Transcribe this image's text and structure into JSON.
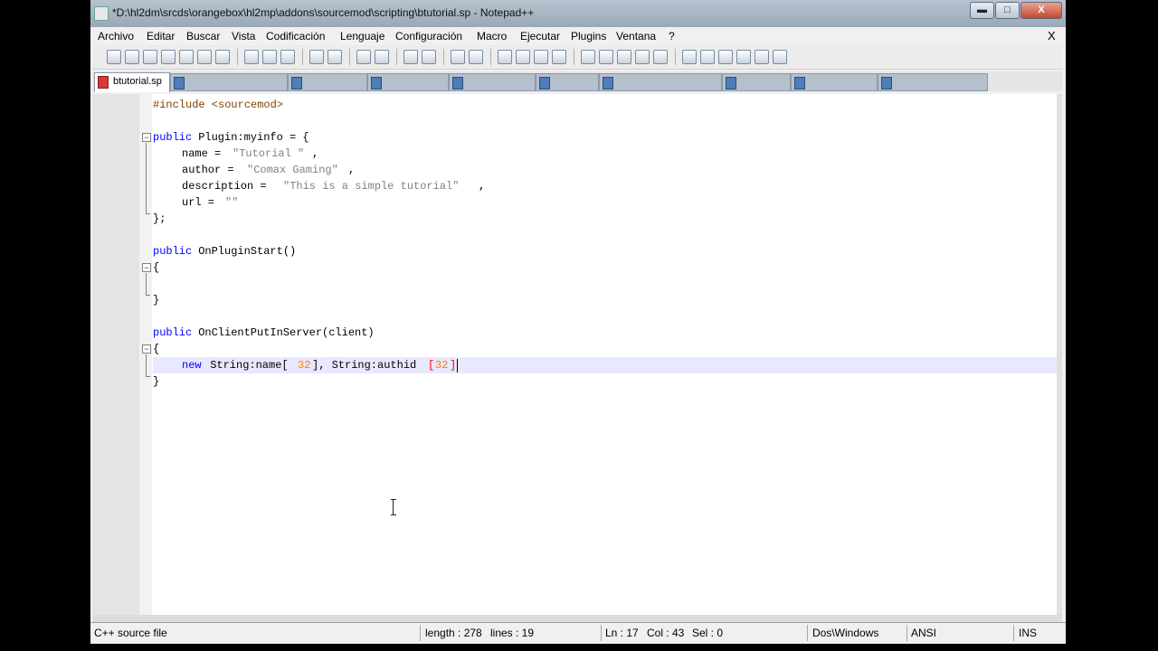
{
  "window": {
    "title": "*D:\\hl2dm\\srcds\\orangebox\\hl2mp\\addons\\sourcemod\\scripting\\btutorial.sp - Notepad++",
    "min_glyph": "▬",
    "max_glyph": "□",
    "close_glyph": "X"
  },
  "menu": {
    "items": [
      "Archivo",
      "Editar",
      "Buscar",
      "Vista",
      "Codificación",
      "Lenguaje",
      "Configuración",
      "Macro",
      "Ejecutar",
      "Plugins",
      "Ventana",
      "?"
    ],
    "close": "X"
  },
  "tabs": {
    "active_label": "btutorial.sp"
  },
  "code": {
    "l1": "#include <sourcemod>",
    "l3_kw": "public",
    "l3_rest": " Plugin:myinfo = {",
    "l4_a": "name = ",
    "l4_s": "\"Tutorial \"",
    "l4_b": ",",
    "l5_a": "author = ",
    "l5_s": "\"Comax Gaming\"",
    "l5_b": ",",
    "l6_a": "description = ",
    "l6_s": "\"This is a simple tutorial\"",
    "l6_b": ",",
    "l7_a": "url = ",
    "l7_s": "\"\"",
    "l8": "};",
    "l10_kw": "public",
    "l10_rest": " OnPluginStart()",
    "l11": "{",
    "l13": "}",
    "l15_kw": "public",
    "l15_rest": " OnClientPutInServer(client)",
    "l16": "{",
    "l17_kw": "new",
    "l17_a": " String:name[",
    "l17_n1": "32",
    "l17_b": "], String:authid",
    "l17_c": "[",
    "l17_n2": "32",
    "l17_d": "]",
    "l18": "}"
  },
  "status": {
    "filetype": "C++ source file",
    "length": "length : 278",
    "lines": "lines : 19",
    "ln": "Ln : 17",
    "col": "Col : 43",
    "sel": "Sel : 0",
    "eol": "Dos\\Windows",
    "encoding": "ANSI",
    "mode": "INS"
  }
}
